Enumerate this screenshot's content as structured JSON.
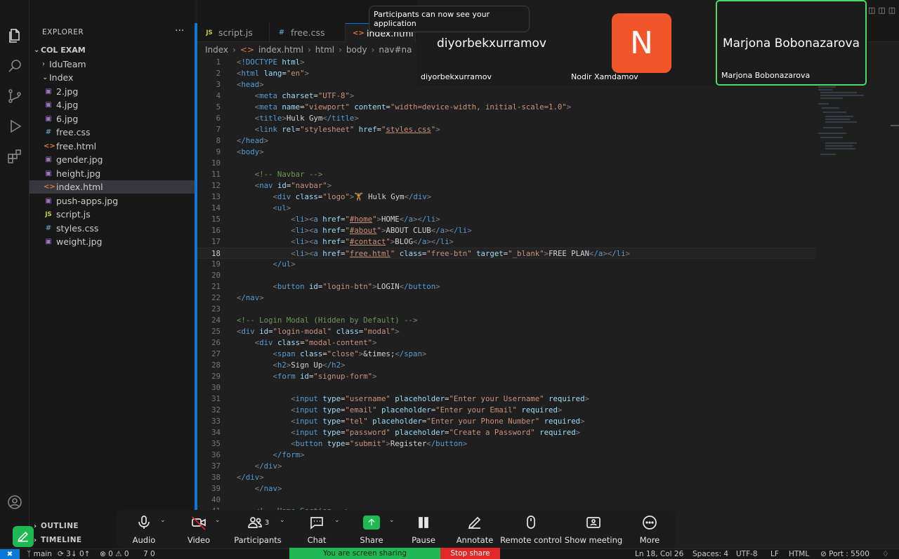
{
  "explorer": {
    "header": "EXPLORER",
    "more": "···",
    "root": "COL EXAM",
    "items": [
      {
        "label": "IduTeam",
        "kind": "folder"
      },
      {
        "label": "Index",
        "kind": "folder"
      },
      {
        "label": "2.jpg",
        "kind": "img"
      },
      {
        "label": "4.jpg",
        "kind": "img"
      },
      {
        "label": "6.jpg",
        "kind": "img"
      },
      {
        "label": "free.css",
        "kind": "css"
      },
      {
        "label": "free.html",
        "kind": "html"
      },
      {
        "label": "gender.jpg",
        "kind": "img"
      },
      {
        "label": "height.jpg",
        "kind": "img"
      },
      {
        "label": "index.html",
        "kind": "html"
      },
      {
        "label": "push-apps.jpg",
        "kind": "img"
      },
      {
        "label": "script.js",
        "kind": "js"
      },
      {
        "label": "styles.css",
        "kind": "css"
      },
      {
        "label": "weight.jpg",
        "kind": "img"
      }
    ],
    "outline": "OUTLINE",
    "timeline": "TIMELINE"
  },
  "tabs": [
    {
      "label": "script.js",
      "icon": "JS"
    },
    {
      "label": "free.css",
      "icon": "#"
    },
    {
      "label": "index.html",
      "icon": "<>"
    }
  ],
  "breadcrumb": [
    "Index",
    "index.html",
    "html",
    "body",
    "nav#na"
  ],
  "code": {
    "current_line": 18,
    "lines": [
      "<!DOCTYPE html>",
      "<html lang=\"en\">",
      "<head>",
      "    <meta charset=\"UTF-8\">",
      "    <meta name=\"viewport\" content=\"width=device-width, initial-scale=1.0\">",
      "    <title>Hulk Gym</title>",
      "    <link rel=\"stylesheet\" href=\"styles.css\">",
      "</head>",
      "<body>",
      "",
      "    <!-- Navbar -->",
      "    <nav id=\"navbar\">",
      "        <div class=\"logo\">🏋 Hulk Gym</div>",
      "        <ul>",
      "            <li><a href=\"#home\">HOME</a></li>",
      "            <li><a href=\"#about\">ABOUT CLUB</a></li>",
      "            <li><a href=\"#contact\">BLOG</a></li>",
      "            <li><a href=\"free.html\" class=\"free-btn\" target=\"_blank\">FREE PLAN</a></li>",
      "        </ul>",
      "",
      "        <button id=\"login-btn\">LOGIN</button>",
      "</nav>",
      "",
      "<!-- Login Modal (Hidden by Default) -->",
      "<div id=\"login-modal\" class=\"modal\">",
      "    <div class=\"modal-content\">",
      "        <span class=\"close\">&times;</span>",
      "        <h2>Sign Up</h2>",
      "        <form id=\"signup-form\">",
      "",
      "            <input type=\"username\" placeholder=\"Enter your Username\" required>",
      "            <input type=\"email\" placeholder=\"Enter your Email\" required>",
      "            <input type=\"tel\" placeholder=\"Enter your Phone Number\" required>",
      "            <input type=\"password\" placeholder=\"Create a Password\" required>",
      "            <button type=\"submit\">Register</button>",
      "        </form>",
      "    </div>",
      "</div>",
      "    </nav>",
      "",
      "    <!-- Home Section -->"
    ]
  },
  "zoom": {
    "toast": "Participants can now see your application",
    "participants": [
      {
        "big_name": "diyorbekxurramov",
        "name": "diyorbekxurramov"
      },
      {
        "initial": "N",
        "name": "Nodir Xamdamov",
        "avatar_color": "#f1562a"
      },
      {
        "big_name": "Marjona Bobonazarova",
        "name": "Marjona Bobonazarova",
        "speaking": true
      }
    ],
    "controls": [
      {
        "label": "Audio"
      },
      {
        "label": "Video"
      },
      {
        "label": "Participants",
        "count": "3"
      },
      {
        "label": "Chat"
      },
      {
        "label": "Share"
      },
      {
        "label": "Pause"
      },
      {
        "label": "Annotate"
      },
      {
        "label": "Remote control"
      },
      {
        "label": "Show meeting"
      },
      {
        "label": "More"
      }
    ],
    "sharing_text": "You are screen sharing",
    "stop_share": "Stop share",
    "accent_green": "#1fb953",
    "stop_red": "#e02828"
  },
  "status": {
    "branch": "main",
    "sync": "3↓ 0↑",
    "problems": "⊗ 0 ⚠ 0",
    "ports": "὚7 0",
    "position": "Ln 18, Col 26",
    "spaces": "Spaces: 4",
    "encoding": "UTF-8",
    "eol": "LF",
    "language": "HTML",
    "live_server": "⊘ Port : 5500"
  }
}
